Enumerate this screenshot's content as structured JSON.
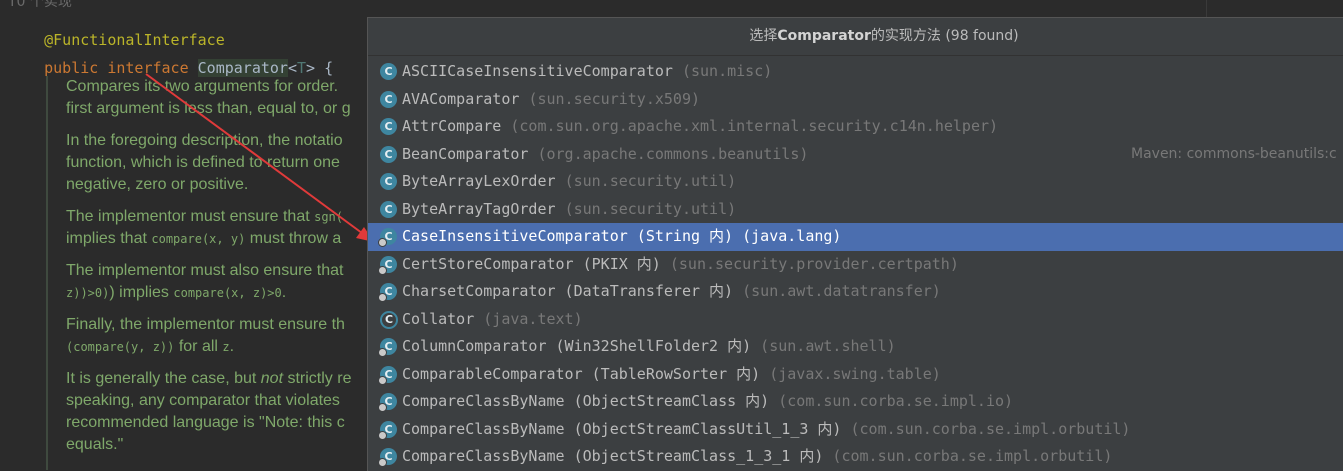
{
  "editor": {
    "cut_top_text": "T0 个实现",
    "annotation": "@FunctionalInterface",
    "decl": {
      "kw1": "public",
      "kw2": "interface",
      "name": "Comparator",
      "lt": "<",
      "type_param": "T",
      "rest": "> {"
    },
    "doc": [
      {
        "l1": "Compares its two arguments for order.",
        "l2": "first argument is less than, equal to, or g"
      },
      {
        "l1": "In the foregoing description, the notatio",
        "l2": "function, which is defined to return one",
        "l3": "negative, zero or positive."
      },
      {
        "l1a": "The implementor must ensure that ",
        "l1b": "sgn(",
        "l2a": "implies that ",
        "l2b": "compare(x, y)",
        "l2c": " must throw a"
      },
      {
        "l1": "The implementor must also ensure that",
        "l2a": "z))>0)",
        "l2b": ") implies ",
        "l2c": "compare(x, z)>0",
        "l2d": "."
      },
      {
        "l1": "Finally, the implementor must ensure th",
        "l2a": "(compare(y, z))",
        "l2b": " for all ",
        "l2c": "z",
        "l2d": "."
      },
      {
        "l1a": "It is generally the case, but ",
        "l1b": "not",
        "l1c": " strictly re",
        "l2": "speaking, any comparator that violates",
        "l3": "recommended language is \"Note: this c",
        "l4": "equals.\""
      }
    ]
  },
  "popup": {
    "title_prefix": "选择",
    "title_bold": "Comparator",
    "title_suffix": "的实现方法 (98 found)",
    "items": [
      {
        "name": "ASCIICaseInsensitiveComparator",
        "pkg": "(sun.misc)"
      },
      {
        "name": "AVAComparator",
        "pkg": "(sun.security.x509)"
      },
      {
        "name": "AttrCompare",
        "pkg": "(com.sun.org.apache.xml.internal.security.c14n.helper)"
      },
      {
        "name": "BeanComparator",
        "pkg": "(org.apache.commons.beanutils)",
        "extra": "Maven: commons-beanutils:c"
      },
      {
        "name": "ByteArrayLexOrder",
        "pkg": "(sun.security.util)"
      },
      {
        "name": "ByteArrayTagOrder",
        "pkg": "(sun.security.util)"
      },
      {
        "name": "CaseInsensitiveComparator (String 内)",
        "pkg": "(java.lang)",
        "selected": true,
        "inner": true
      },
      {
        "name": "CertStoreComparator (PKIX 内)",
        "pkg": "(sun.security.provider.certpath)",
        "inner": true
      },
      {
        "name": "CharsetComparator (DataTransferer 内)",
        "pkg": "(sun.awt.datatransfer)",
        "inner": true
      },
      {
        "name": "Collator",
        "pkg": "(java.text)",
        "abstract": true
      },
      {
        "name": "ColumnComparator (Win32ShellFolder2 内)",
        "pkg": "(sun.awt.shell)",
        "inner": true
      },
      {
        "name": "ComparableComparator (TableRowSorter 内)",
        "pkg": "(javax.swing.table)",
        "inner": true
      },
      {
        "name": "CompareClassByName (ObjectStreamClass 内)",
        "pkg": "(com.sun.corba.se.impl.io)",
        "inner": true
      },
      {
        "name": "CompareClassByName (ObjectStreamClassUtil_1_3 内)",
        "pkg": "(com.sun.corba.se.impl.orbutil)",
        "inner": true
      },
      {
        "name": "CompareClassByName (ObjectStreamClass_1_3_1 内)",
        "pkg": "(com.sun.corba.se.impl.orbutil)",
        "inner": true
      }
    ],
    "icon_letter": "C"
  },
  "colors": {
    "selection": "#4b6eaf",
    "doc_text": "#7fa86a",
    "keyword": "#cc7832",
    "annotation": "#bbb529",
    "arrow": "#e03a3a"
  }
}
